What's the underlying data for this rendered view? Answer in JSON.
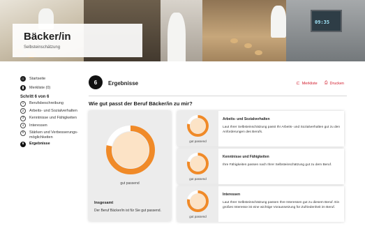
{
  "hero": {
    "title": "Bäcker/in",
    "subtitle": "Selbsteinschätzung",
    "oven_display": "09:35"
  },
  "sidebar": {
    "links": [
      {
        "icon": "home-icon",
        "label": "Startseite"
      },
      {
        "icon": "bookmark-icon",
        "label": "Merkliste (0)"
      }
    ],
    "step_heading": "Schritt 6 von 6",
    "steps": [
      {
        "num": "1",
        "label": "Berufsbeschreibung"
      },
      {
        "num": "2",
        "label": "Arbeits- und Sozialverhalten"
      },
      {
        "num": "3",
        "label": "Kenntnisse und Fähigkeiten"
      },
      {
        "num": "4",
        "label": "Interessen"
      },
      {
        "num": "5",
        "label": "Stärken und Verbesserungs-möglichkeiten"
      },
      {
        "num": "6",
        "label": "Ergebnisse",
        "active": true
      }
    ]
  },
  "main": {
    "step_number": "6",
    "section_title": "Ergebnisse",
    "actions": [
      {
        "icon": "bookmark-icon",
        "label": "Merkliste"
      },
      {
        "icon": "print-icon",
        "label": "Drucken"
      }
    ],
    "question": "Wie gut passt der Beruf Bäcker/in zu mir?",
    "total": {
      "rating": "gut passend",
      "heading": "Insgesamt",
      "text": "Der Beruf Bäcker/in ist für Sie gut passend.",
      "score_fraction": 0.78
    },
    "categories": [
      {
        "heading": "Arbeits- und Sozialverhalten",
        "rating": "gut passend",
        "text": "Laut Ihrer Selbsteinschätzung passt Ihr Arbeits- und Sozialverhalten gut zu den Anforderungen des Berufs.",
        "score_fraction": 0.78
      },
      {
        "heading": "Kenntnisse und Fähigkeiten",
        "rating": "gut passend",
        "text": "Ihre Fähigkeiten passen nach Ihrer Selbsteinschätzung gut zu dem Beruf.",
        "score_fraction": 0.78
      },
      {
        "heading": "Interessen",
        "rating": "gut passend",
        "text": "Laut Ihrer Selbsteinschätzung passen Ihre Interessen gut zu diesem Beruf. Ein großes Interesse ist eine wichtige Voraussetzung für Zufriedenheit im Beruf.",
        "score_fraction": 0.78
      }
    ]
  },
  "colors": {
    "accent_red": "#d11a2a",
    "ring_orange": "#f08a28",
    "ring_fill": "#fce3c6",
    "ring_track": "#ffffff"
  }
}
